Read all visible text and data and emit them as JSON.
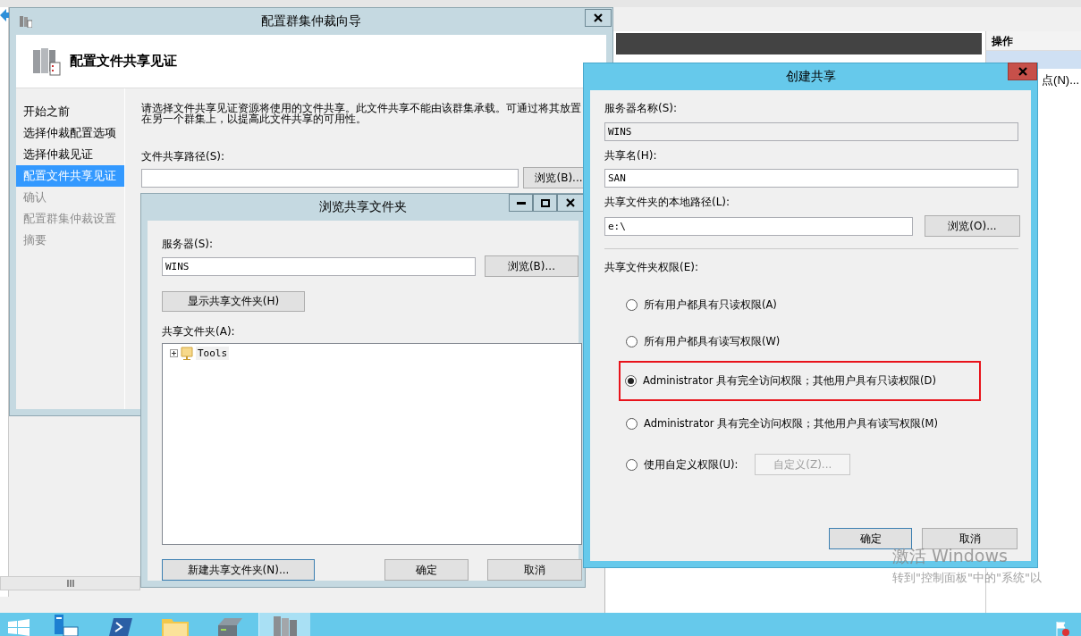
{
  "background": {
    "actions_header": "操作",
    "action_item": "点(N)..."
  },
  "wizard": {
    "title": "配置群集仲裁向导",
    "header": "配置文件共享见证",
    "steps": [
      {
        "label": "开始之前",
        "selected": false,
        "disabled": false
      },
      {
        "label": "选择仲裁配置选项",
        "selected": false,
        "disabled": false
      },
      {
        "label": "选择仲裁见证",
        "selected": false,
        "disabled": false
      },
      {
        "label": "配置文件共享见证",
        "selected": true,
        "disabled": false
      },
      {
        "label": "确认",
        "selected": false,
        "disabled": true
      },
      {
        "label": "配置群集仲裁设置",
        "selected": false,
        "disabled": true
      },
      {
        "label": "摘要",
        "selected": false,
        "disabled": true
      }
    ],
    "description": "请选择文件共享见证资源将使用的文件共享。此文件共享不能由该群集承载。可通过将其放置在另一个群集上，以提高此文件共享的可用性。",
    "path_label": "文件共享路径(S):",
    "browse_button": "浏览(B)..."
  },
  "browse_dialog": {
    "title": "浏览共享文件夹",
    "server_label": "服务器(S):",
    "server_value": "WINS",
    "browse_button": "浏览(B)...",
    "show_button": "显示共享文件夹(H)",
    "folders_label": "共享文件夹(A):",
    "folders": [
      {
        "label": "Tools",
        "expanded": false
      }
    ],
    "new_button": "新建共享文件夹(N)...",
    "ok_button": "确定",
    "cancel_button": "取消"
  },
  "create_share": {
    "title": "创建共享",
    "server_label": "服务器名称(S):",
    "server_value": "WINS",
    "share_label": "共享名(H):",
    "share_value": "SAN",
    "path_label": "共享文件夹的本地路径(L):",
    "path_value": "e:\\",
    "browse_button": "浏览(O)...",
    "permissions_label": "共享文件夹权限(E):",
    "options": [
      {
        "label": "所有用户都具有只读权限(A)",
        "selected": false,
        "highlighted": false
      },
      {
        "label": "所有用户都具有读写权限(W)",
        "selected": false,
        "highlighted": false
      },
      {
        "label": "Administrator 具有完全访问权限；其他用户具有只读权限(D)",
        "selected": true,
        "highlighted": true
      },
      {
        "label": "Administrator 具有完全访问权限；其他用户具有读写权限(M)",
        "selected": false,
        "highlighted": false
      },
      {
        "label": "使用自定义权限(U):",
        "selected": false,
        "highlighted": false
      }
    ],
    "custom_button": {
      "label": "自定义(Z)...",
      "disabled": true
    },
    "ok_button": "确定",
    "cancel_button": "取消"
  },
  "activation": {
    "title": "激活 Windows",
    "subtitle": "转到\"控制面板\"中的\"系统\"以"
  },
  "taskbar": {
    "items": [
      {
        "kind": "start",
        "selected": false
      },
      {
        "kind": "server",
        "selected": false
      },
      {
        "kind": "shell",
        "selected": false
      },
      {
        "kind": "folder",
        "selected": false
      },
      {
        "kind": "drive",
        "selected": false
      },
      {
        "kind": "cluster",
        "selected": true
      }
    ]
  }
}
